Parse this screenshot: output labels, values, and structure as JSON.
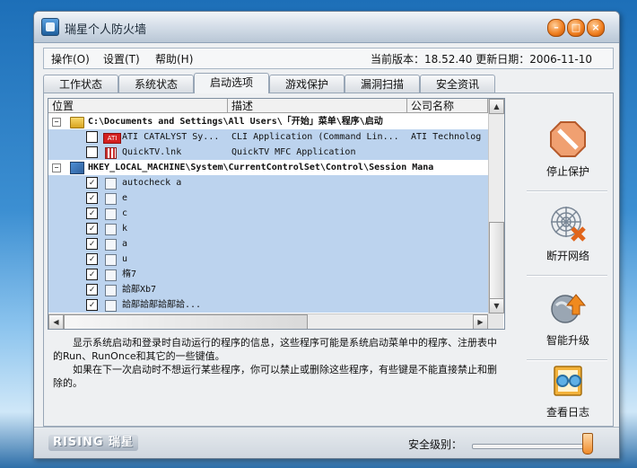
{
  "window": {
    "title": "瑞星个人防火墙"
  },
  "menu": {
    "items": [
      {
        "label": "操作(O)"
      },
      {
        "label": "设置(T)"
      },
      {
        "label": "帮助(H)"
      }
    ],
    "version_text": "当前版本：18.52.40    更新日期：2006-11-10"
  },
  "tabs": [
    {
      "label": "工作状态"
    },
    {
      "label": "系统状态"
    },
    {
      "label": "启动选项"
    },
    {
      "label": "游戏保护"
    },
    {
      "label": "漏洞扫描"
    },
    {
      "label": "安全资讯"
    }
  ],
  "list": {
    "columns": [
      "位置",
      "描述",
      "公司名称"
    ],
    "groups": [
      {
        "path": "C:\\Documents and Settings\\All Users\\「开始」菜单\\程序\\启动",
        "items": [
          {
            "name": "ATI CATALYST Sy...",
            "desc": "CLI Application (Command Lin...",
            "company": "ATI Technolog",
            "checked": false,
            "icon": "ati-icon"
          },
          {
            "name": "QuickTV.lnk",
            "desc": "QuickTV MFC Application",
            "company": "",
            "checked": false,
            "icon": "quicktv-icon"
          }
        ]
      },
      {
        "path": "HKEY_LOCAL_MACHINE\\System\\CurrentControlSet\\Control\\Session Mana",
        "items": [
          {
            "name": "autocheck a",
            "checked": true
          },
          {
            "name": "e",
            "checked": true
          },
          {
            "name": "c",
            "checked": true
          },
          {
            "name": "k",
            "checked": true
          },
          {
            "name": "a",
            "checked": true
          },
          {
            "name": "u",
            "checked": true
          },
          {
            "name": "楕7",
            "checked": true
          },
          {
            "name": "詥鄗Xb7",
            "checked": true
          },
          {
            "name": "詥鄗詥鄗詥鄗詥...",
            "checked": true
          }
        ]
      }
    ]
  },
  "description": {
    "line1": "显示系统启动和登录时自动运行的程序的信息，这些程序可能是系统启动菜单中的程序、注册表中的Run、RunOnce和其它的一些键值。",
    "line2": "如果在下一次启动时不想运行某些程序，你可以禁止或删除这些程序，有些键是不能直接禁止和删除的。"
  },
  "side_buttons": [
    {
      "label": "停止保护",
      "icon": "stop-protection-icon"
    },
    {
      "label": "断开网络",
      "icon": "disconnect-network-icon"
    },
    {
      "label": "智能升级",
      "icon": "smart-upgrade-icon"
    },
    {
      "label": "查看日志",
      "icon": "view-log-icon"
    }
  ],
  "status": {
    "brand": "RISING 瑞星",
    "security_level_label": "安全级别："
  }
}
